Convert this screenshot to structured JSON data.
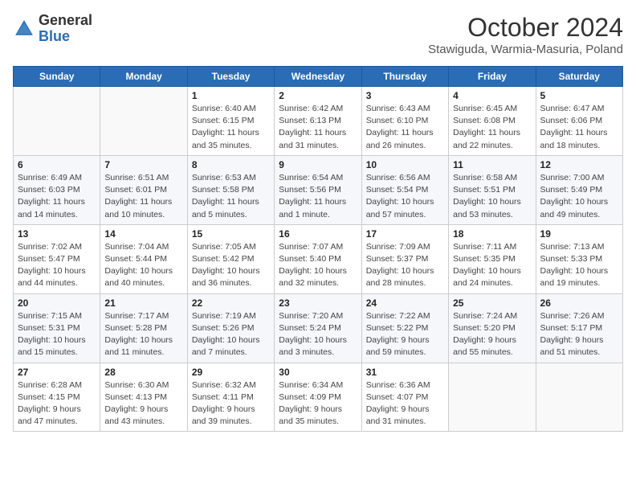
{
  "header": {
    "logo": {
      "general": "General",
      "blue": "Blue"
    },
    "title": "October 2024",
    "location": "Stawiguda, Warmia-Masuria, Poland"
  },
  "calendar": {
    "days_of_week": [
      "Sunday",
      "Monday",
      "Tuesday",
      "Wednesday",
      "Thursday",
      "Friday",
      "Saturday"
    ],
    "weeks": [
      [
        {
          "day": "",
          "sunrise": "",
          "sunset": "",
          "daylight": ""
        },
        {
          "day": "",
          "sunrise": "",
          "sunset": "",
          "daylight": ""
        },
        {
          "day": "1",
          "sunrise": "Sunrise: 6:40 AM",
          "sunset": "Sunset: 6:15 PM",
          "daylight": "Daylight: 11 hours and 35 minutes."
        },
        {
          "day": "2",
          "sunrise": "Sunrise: 6:42 AM",
          "sunset": "Sunset: 6:13 PM",
          "daylight": "Daylight: 11 hours and 31 minutes."
        },
        {
          "day": "3",
          "sunrise": "Sunrise: 6:43 AM",
          "sunset": "Sunset: 6:10 PM",
          "daylight": "Daylight: 11 hours and 26 minutes."
        },
        {
          "day": "4",
          "sunrise": "Sunrise: 6:45 AM",
          "sunset": "Sunset: 6:08 PM",
          "daylight": "Daylight: 11 hours and 22 minutes."
        },
        {
          "day": "5",
          "sunrise": "Sunrise: 6:47 AM",
          "sunset": "Sunset: 6:06 PM",
          "daylight": "Daylight: 11 hours and 18 minutes."
        }
      ],
      [
        {
          "day": "6",
          "sunrise": "Sunrise: 6:49 AM",
          "sunset": "Sunset: 6:03 PM",
          "daylight": "Daylight: 11 hours and 14 minutes."
        },
        {
          "day": "7",
          "sunrise": "Sunrise: 6:51 AM",
          "sunset": "Sunset: 6:01 PM",
          "daylight": "Daylight: 11 hours and 10 minutes."
        },
        {
          "day": "8",
          "sunrise": "Sunrise: 6:53 AM",
          "sunset": "Sunset: 5:58 PM",
          "daylight": "Daylight: 11 hours and 5 minutes."
        },
        {
          "day": "9",
          "sunrise": "Sunrise: 6:54 AM",
          "sunset": "Sunset: 5:56 PM",
          "daylight": "Daylight: 11 hours and 1 minute."
        },
        {
          "day": "10",
          "sunrise": "Sunrise: 6:56 AM",
          "sunset": "Sunset: 5:54 PM",
          "daylight": "Daylight: 10 hours and 57 minutes."
        },
        {
          "day": "11",
          "sunrise": "Sunrise: 6:58 AM",
          "sunset": "Sunset: 5:51 PM",
          "daylight": "Daylight: 10 hours and 53 minutes."
        },
        {
          "day": "12",
          "sunrise": "Sunrise: 7:00 AM",
          "sunset": "Sunset: 5:49 PM",
          "daylight": "Daylight: 10 hours and 49 minutes."
        }
      ],
      [
        {
          "day": "13",
          "sunrise": "Sunrise: 7:02 AM",
          "sunset": "Sunset: 5:47 PM",
          "daylight": "Daylight: 10 hours and 44 minutes."
        },
        {
          "day": "14",
          "sunrise": "Sunrise: 7:04 AM",
          "sunset": "Sunset: 5:44 PM",
          "daylight": "Daylight: 10 hours and 40 minutes."
        },
        {
          "day": "15",
          "sunrise": "Sunrise: 7:05 AM",
          "sunset": "Sunset: 5:42 PM",
          "daylight": "Daylight: 10 hours and 36 minutes."
        },
        {
          "day": "16",
          "sunrise": "Sunrise: 7:07 AM",
          "sunset": "Sunset: 5:40 PM",
          "daylight": "Daylight: 10 hours and 32 minutes."
        },
        {
          "day": "17",
          "sunrise": "Sunrise: 7:09 AM",
          "sunset": "Sunset: 5:37 PM",
          "daylight": "Daylight: 10 hours and 28 minutes."
        },
        {
          "day": "18",
          "sunrise": "Sunrise: 7:11 AM",
          "sunset": "Sunset: 5:35 PM",
          "daylight": "Daylight: 10 hours and 24 minutes."
        },
        {
          "day": "19",
          "sunrise": "Sunrise: 7:13 AM",
          "sunset": "Sunset: 5:33 PM",
          "daylight": "Daylight: 10 hours and 19 minutes."
        }
      ],
      [
        {
          "day": "20",
          "sunrise": "Sunrise: 7:15 AM",
          "sunset": "Sunset: 5:31 PM",
          "daylight": "Daylight: 10 hours and 15 minutes."
        },
        {
          "day": "21",
          "sunrise": "Sunrise: 7:17 AM",
          "sunset": "Sunset: 5:28 PM",
          "daylight": "Daylight: 10 hours and 11 minutes."
        },
        {
          "day": "22",
          "sunrise": "Sunrise: 7:19 AM",
          "sunset": "Sunset: 5:26 PM",
          "daylight": "Daylight: 10 hours and 7 minutes."
        },
        {
          "day": "23",
          "sunrise": "Sunrise: 7:20 AM",
          "sunset": "Sunset: 5:24 PM",
          "daylight": "Daylight: 10 hours and 3 minutes."
        },
        {
          "day": "24",
          "sunrise": "Sunrise: 7:22 AM",
          "sunset": "Sunset: 5:22 PM",
          "daylight": "Daylight: 9 hours and 59 minutes."
        },
        {
          "day": "25",
          "sunrise": "Sunrise: 7:24 AM",
          "sunset": "Sunset: 5:20 PM",
          "daylight": "Daylight: 9 hours and 55 minutes."
        },
        {
          "day": "26",
          "sunrise": "Sunrise: 7:26 AM",
          "sunset": "Sunset: 5:17 PM",
          "daylight": "Daylight: 9 hours and 51 minutes."
        }
      ],
      [
        {
          "day": "27",
          "sunrise": "Sunrise: 6:28 AM",
          "sunset": "Sunset: 4:15 PM",
          "daylight": "Daylight: 9 hours and 47 minutes."
        },
        {
          "day": "28",
          "sunrise": "Sunrise: 6:30 AM",
          "sunset": "Sunset: 4:13 PM",
          "daylight": "Daylight: 9 hours and 43 minutes."
        },
        {
          "day": "29",
          "sunrise": "Sunrise: 6:32 AM",
          "sunset": "Sunset: 4:11 PM",
          "daylight": "Daylight: 9 hours and 39 minutes."
        },
        {
          "day": "30",
          "sunrise": "Sunrise: 6:34 AM",
          "sunset": "Sunset: 4:09 PM",
          "daylight": "Daylight: 9 hours and 35 minutes."
        },
        {
          "day": "31",
          "sunrise": "Sunrise: 6:36 AM",
          "sunset": "Sunset: 4:07 PM",
          "daylight": "Daylight: 9 hours and 31 minutes."
        },
        {
          "day": "",
          "sunrise": "",
          "sunset": "",
          "daylight": ""
        },
        {
          "day": "",
          "sunrise": "",
          "sunset": "",
          "daylight": ""
        }
      ]
    ]
  }
}
